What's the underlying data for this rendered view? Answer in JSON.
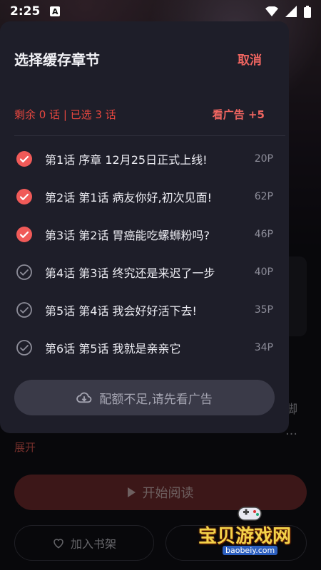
{
  "status_bar": {
    "time": "2:25",
    "app_badge": "A"
  },
  "background": {
    "description_snippet": "脚\n…",
    "expand_label": "展开",
    "start_reading_label": "开始阅读",
    "add_shelf_label": "加入书架"
  },
  "modal": {
    "title": "选择缓存章节",
    "cancel_label": "取消",
    "quota_text": "剩余 0 话 | 已选 3 话",
    "ad_link_label": "看广告 +5",
    "chapters": [
      {
        "title": "第1话 序章 12月25日正式上线!",
        "pages": "20P",
        "selected": true
      },
      {
        "title": "第2话 第1话 病友你好,初次见面!",
        "pages": "62P",
        "selected": true
      },
      {
        "title": "第3话 第2话 胃癌能吃螺蛳粉吗?",
        "pages": "46P",
        "selected": true
      },
      {
        "title": "第4话 第3话 终究还是来迟了一步",
        "pages": "40P",
        "selected": false
      },
      {
        "title": "第5话 第4话 我会好好活下去!",
        "pages": "35P",
        "selected": false
      },
      {
        "title": "第6话 第5话 我就是亲亲它",
        "pages": "34P",
        "selected": false
      }
    ],
    "ad_button_label": "配额不足,请先看广告"
  },
  "watermark": {
    "text": "宝贝游戏网",
    "url": "baobeiy.com"
  },
  "colors": {
    "accent": "#f06560",
    "panel": "#1e1e29",
    "checked": "#f05a58",
    "unchecked": "#8d8d99"
  }
}
